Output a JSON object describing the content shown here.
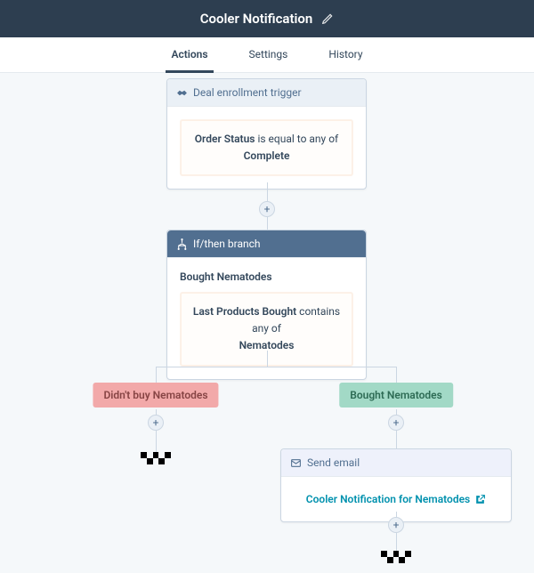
{
  "header": {
    "title": "Cooler Notification"
  },
  "tabs": {
    "actions": "Actions",
    "settings": "Settings",
    "history": "History"
  },
  "trigger": {
    "header": "Deal enrollment trigger",
    "property": "Order Status",
    "operator": " is equal to any of",
    "value": "Complete"
  },
  "branch": {
    "header": "If/then branch",
    "title": "Bought Nematodes",
    "property": "Last Products Bought",
    "operator": " contains any of",
    "value": "Nematodes"
  },
  "branches": {
    "no_label": "Didn't buy Nematodes",
    "yes_label": "Bought Nematodes"
  },
  "email": {
    "header": "Send email",
    "link_text": "Cooler Notification for Nematodes"
  },
  "plus": "+"
}
